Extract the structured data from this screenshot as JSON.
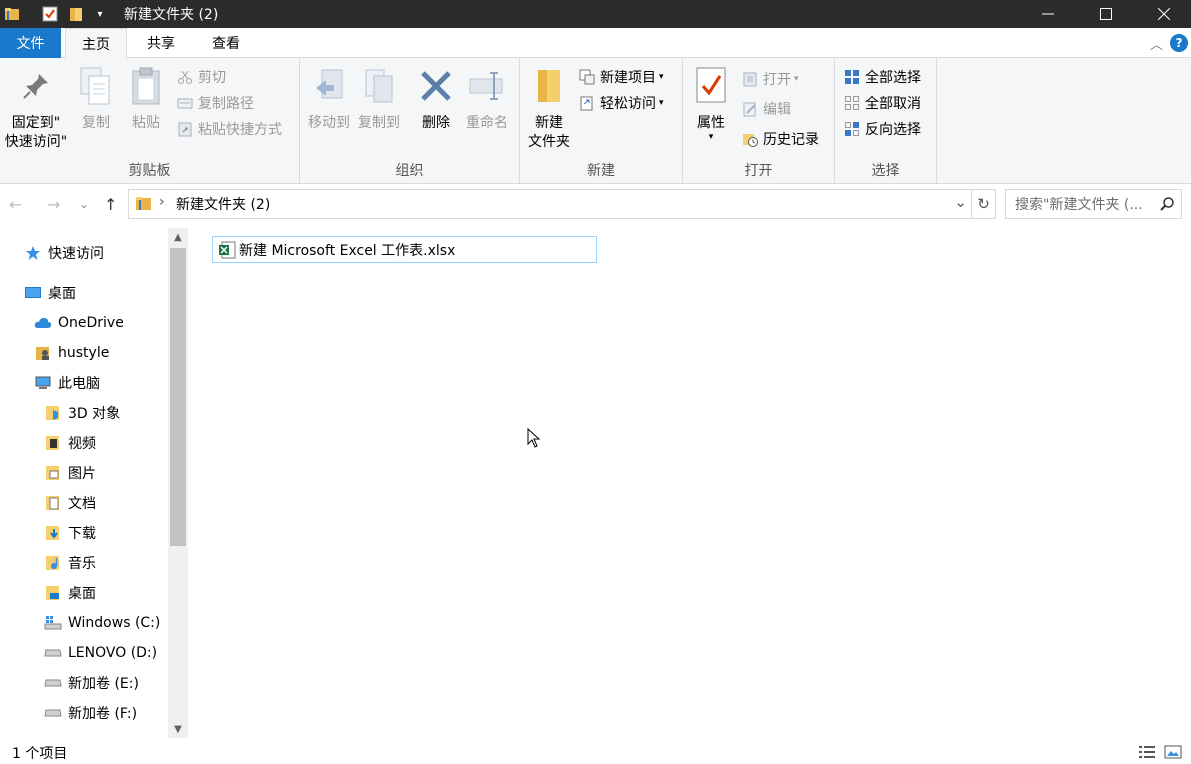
{
  "window": {
    "title": "新建文件夹 (2)",
    "controls": {
      "minimize": "—",
      "maximize": "☐",
      "close": "✕"
    }
  },
  "ribbon_tabs": {
    "file": "文件",
    "home": "主页",
    "share": "共享",
    "view": "查看",
    "help": "?",
    "collapse": "︿"
  },
  "ribbon": {
    "clipboard": {
      "label": "剪贴板",
      "pin_line1": "固定到\"",
      "pin_line2": "快速访问\"",
      "copy": "复制",
      "paste": "粘贴",
      "cut": "剪切",
      "copy_path": "复制路径",
      "paste_shortcut": "粘贴快捷方式"
    },
    "organize": {
      "label": "组织",
      "move_to": "移动到",
      "copy_to": "复制到",
      "delete": "删除",
      "rename": "重命名"
    },
    "new": {
      "label": "新建",
      "new_folder_line1": "新建",
      "new_folder_line2": "文件夹",
      "new_item": "新建项目",
      "easy_access": "轻松访问"
    },
    "open": {
      "label": "打开",
      "properties": "属性",
      "open": "打开",
      "edit": "编辑",
      "history": "历史记录"
    },
    "select": {
      "label": "选择",
      "select_all": "全部选择",
      "select_none": "全部取消",
      "invert": "反向选择"
    }
  },
  "address": {
    "back": "←",
    "forward": "→",
    "recent": "⌄",
    "up": "↑",
    "separator": "›",
    "path": "新建文件夹 (2)",
    "dropdown": "⌄",
    "refresh": "↻",
    "search_placeholder": "搜索\"新建文件夹 (..."
  },
  "nav": {
    "items": [
      {
        "label": "快速访问",
        "icon": "star-icon"
      },
      {
        "label": "桌面",
        "icon": "desktop-icon"
      },
      {
        "label": "OneDrive",
        "icon": "cloud-icon"
      },
      {
        "label": "hustyle",
        "icon": "user-folder-icon"
      },
      {
        "label": "此电脑",
        "icon": "computer-icon"
      },
      {
        "label": "3D 对象",
        "icon": "3d-objects-icon"
      },
      {
        "label": "视频",
        "icon": "video-folder-icon"
      },
      {
        "label": "图片",
        "icon": "pictures-folder-icon"
      },
      {
        "label": "文档",
        "icon": "documents-folder-icon"
      },
      {
        "label": "下载",
        "icon": "downloads-folder-icon"
      },
      {
        "label": "音乐",
        "icon": "music-folder-icon"
      },
      {
        "label": "桌面",
        "icon": "desktop-folder-icon"
      },
      {
        "label": "Windows (C:)",
        "icon": "system-drive-icon"
      },
      {
        "label": "LENOVO (D:)",
        "icon": "drive-icon"
      },
      {
        "label": "新加卷 (E:)",
        "icon": "drive-icon"
      },
      {
        "label": "新加卷 (F:)",
        "icon": "drive-icon"
      }
    ],
    "scroll_up": "▲",
    "scroll_down": "▼"
  },
  "content": {
    "files": [
      {
        "name": "新建 Microsoft Excel 工作表.xlsx",
        "icon": "excel-file-icon"
      }
    ]
  },
  "status": {
    "count": "1 个项目"
  },
  "colors": {
    "accent": "#1979ca",
    "titlebar": "#2b2b2b",
    "ribbon_bg": "#f5f6f7",
    "selection_border": "#99d1ff"
  }
}
